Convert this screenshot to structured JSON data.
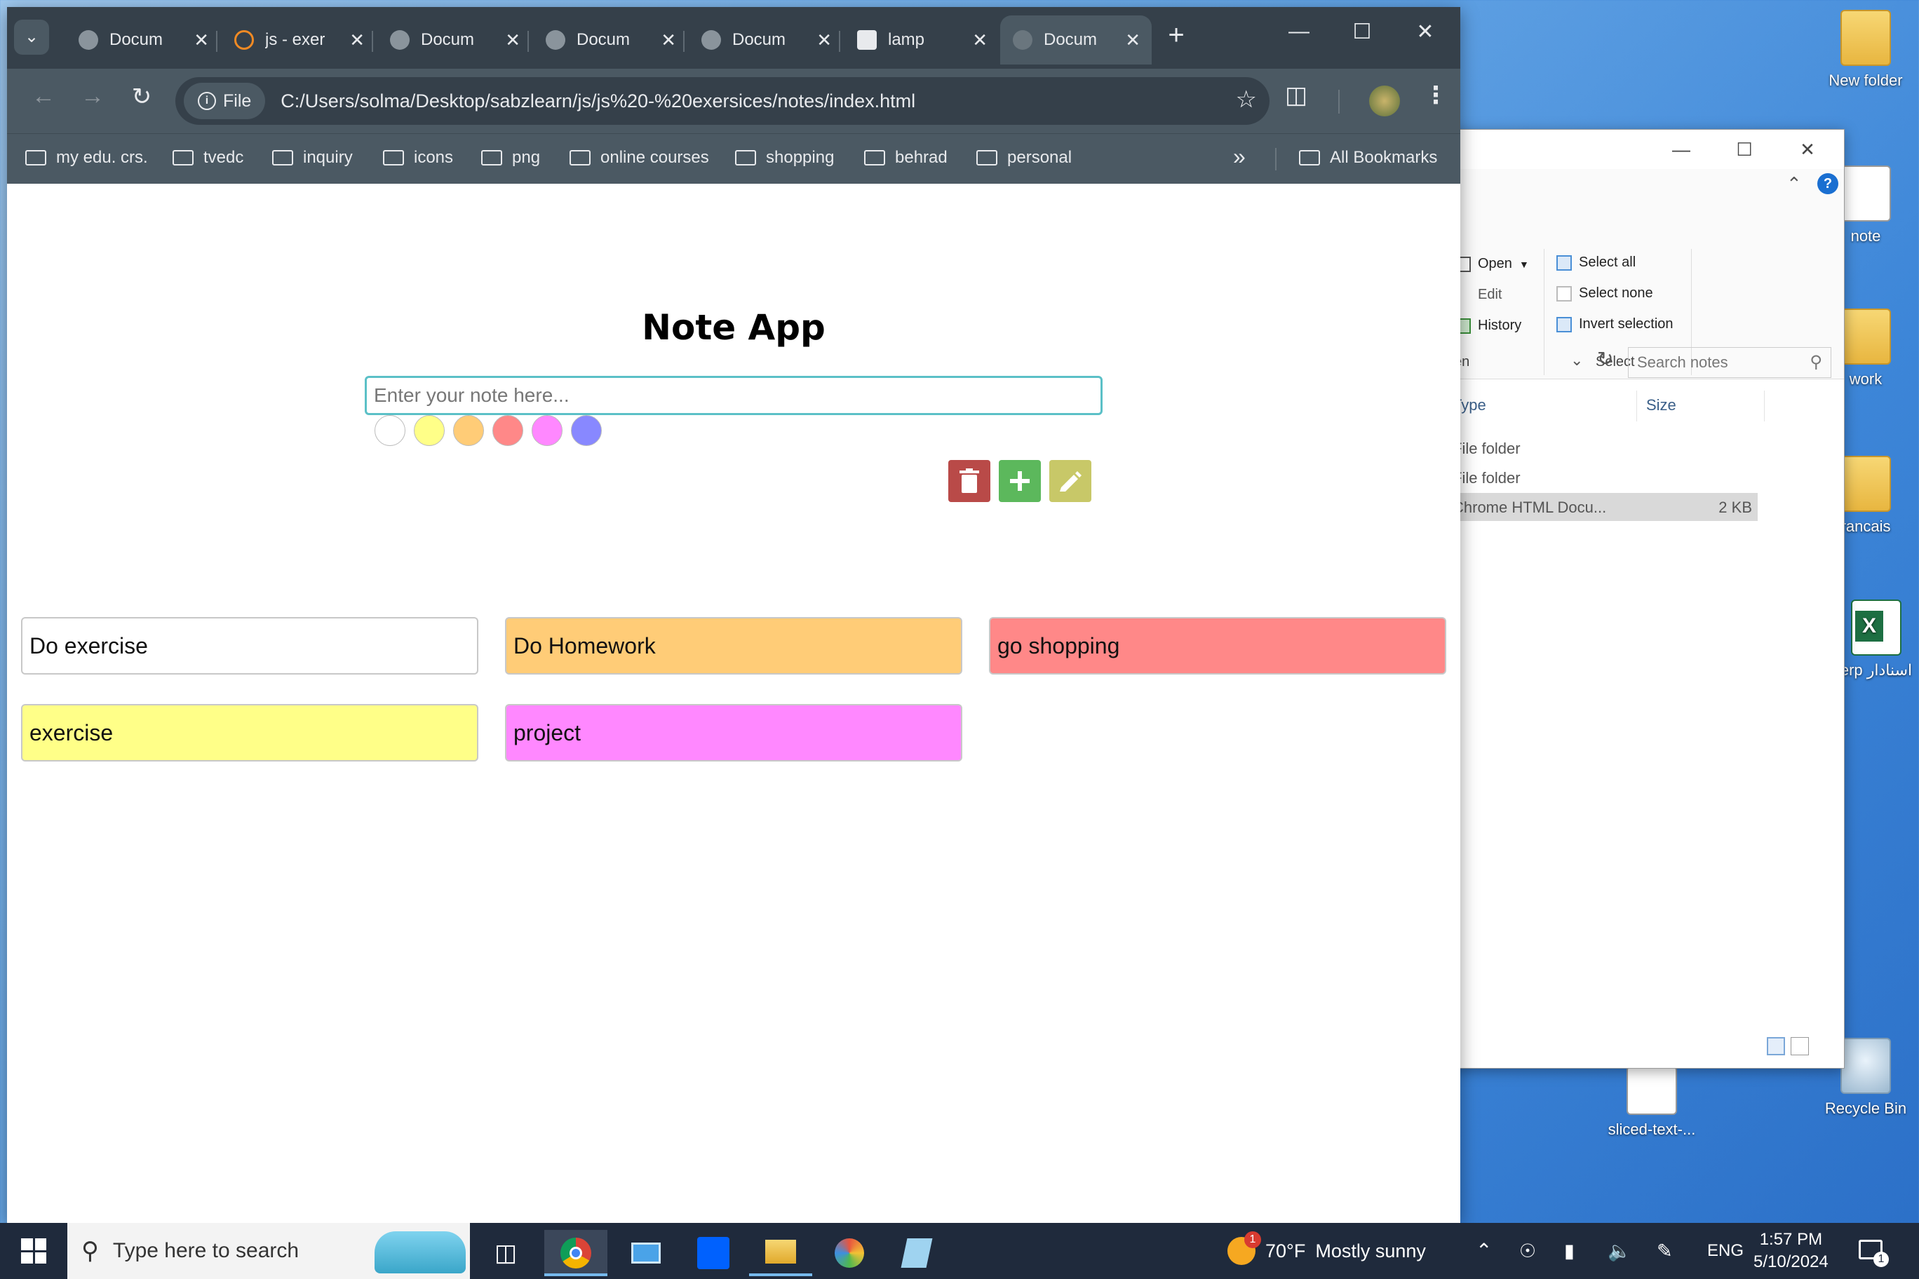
{
  "desktop": {
    "icons": [
      {
        "label": "New folder",
        "kind": "folder"
      },
      {
        "label": "note",
        "kind": "doc"
      },
      {
        "label": "work",
        "kind": "folder"
      },
      {
        "label": "rancais",
        "kind": "folder"
      },
      {
        "label": "erp اسنادار",
        "kind": "excel"
      },
      {
        "label": "sliced-text-...",
        "kind": "doc"
      },
      {
        "label": "Recycle Bin",
        "kind": "bin"
      }
    ]
  },
  "explorer": {
    "ribbon": {
      "open": "Open",
      "edit": "Edit",
      "history": "History",
      "open_group_fragment": "en",
      "select_all": "Select all",
      "select_none": "Select none",
      "invert_selection": "Invert selection",
      "select_group": "Select"
    },
    "search_placeholder": "Search notes",
    "columns": {
      "type": "Type",
      "size": "Size"
    },
    "rows": [
      {
        "type": "File folder",
        "size": ""
      },
      {
        "type": "File folder",
        "size": ""
      },
      {
        "type": "Chrome HTML Docu...",
        "size": "2 KB"
      }
    ]
  },
  "browser": {
    "tabs": [
      {
        "title": "Docum",
        "active": false
      },
      {
        "title": "js - exer",
        "active": false
      },
      {
        "title": "Docum",
        "active": false
      },
      {
        "title": "Docum",
        "active": false
      },
      {
        "title": "Docum",
        "active": false
      },
      {
        "title": "lamp",
        "active": false
      },
      {
        "title": "Docum",
        "active": true
      }
    ],
    "address": {
      "chip_label": "File",
      "url": "C:/Users/solma/Desktop/sabzlearn/js/js%20-%20exersices/notes/index.html"
    },
    "bookmarks": [
      "my edu. crs.",
      "tvedc",
      "inquiry",
      "icons",
      "png",
      "online courses",
      "shopping",
      "behrad",
      "personal"
    ],
    "all_bookmarks": "All Bookmarks"
  },
  "app": {
    "title": "Note App",
    "input_placeholder": "Enter your note here...",
    "input_value": "",
    "colors": [
      "#ffffff",
      "#ffff88",
      "#ffcc77",
      "#ff8888",
      "#ff88ff",
      "#8888ff"
    ],
    "buttons": {
      "delete_color": "#b94a48",
      "add_color": "#5cb85c",
      "edit_color": "#c8c868"
    },
    "notes": [
      {
        "text": "Do exercise",
        "color": "#ffffff"
      },
      {
        "text": "Do Homework",
        "color": "#ffcc77"
      },
      {
        "text": "go shopping",
        "color": "#ff8888"
      },
      {
        "text": "exercise",
        "color": "#ffff88"
      },
      {
        "text": "project",
        "color": "#ff88ff"
      }
    ]
  },
  "taskbar": {
    "search_placeholder": "Type here to search",
    "weather": {
      "temp": "70°F",
      "condition": "Mostly sunny",
      "badge": "1"
    },
    "language": "ENG",
    "time": "1:57 PM",
    "date": "5/10/2024",
    "notification_count": "1"
  }
}
